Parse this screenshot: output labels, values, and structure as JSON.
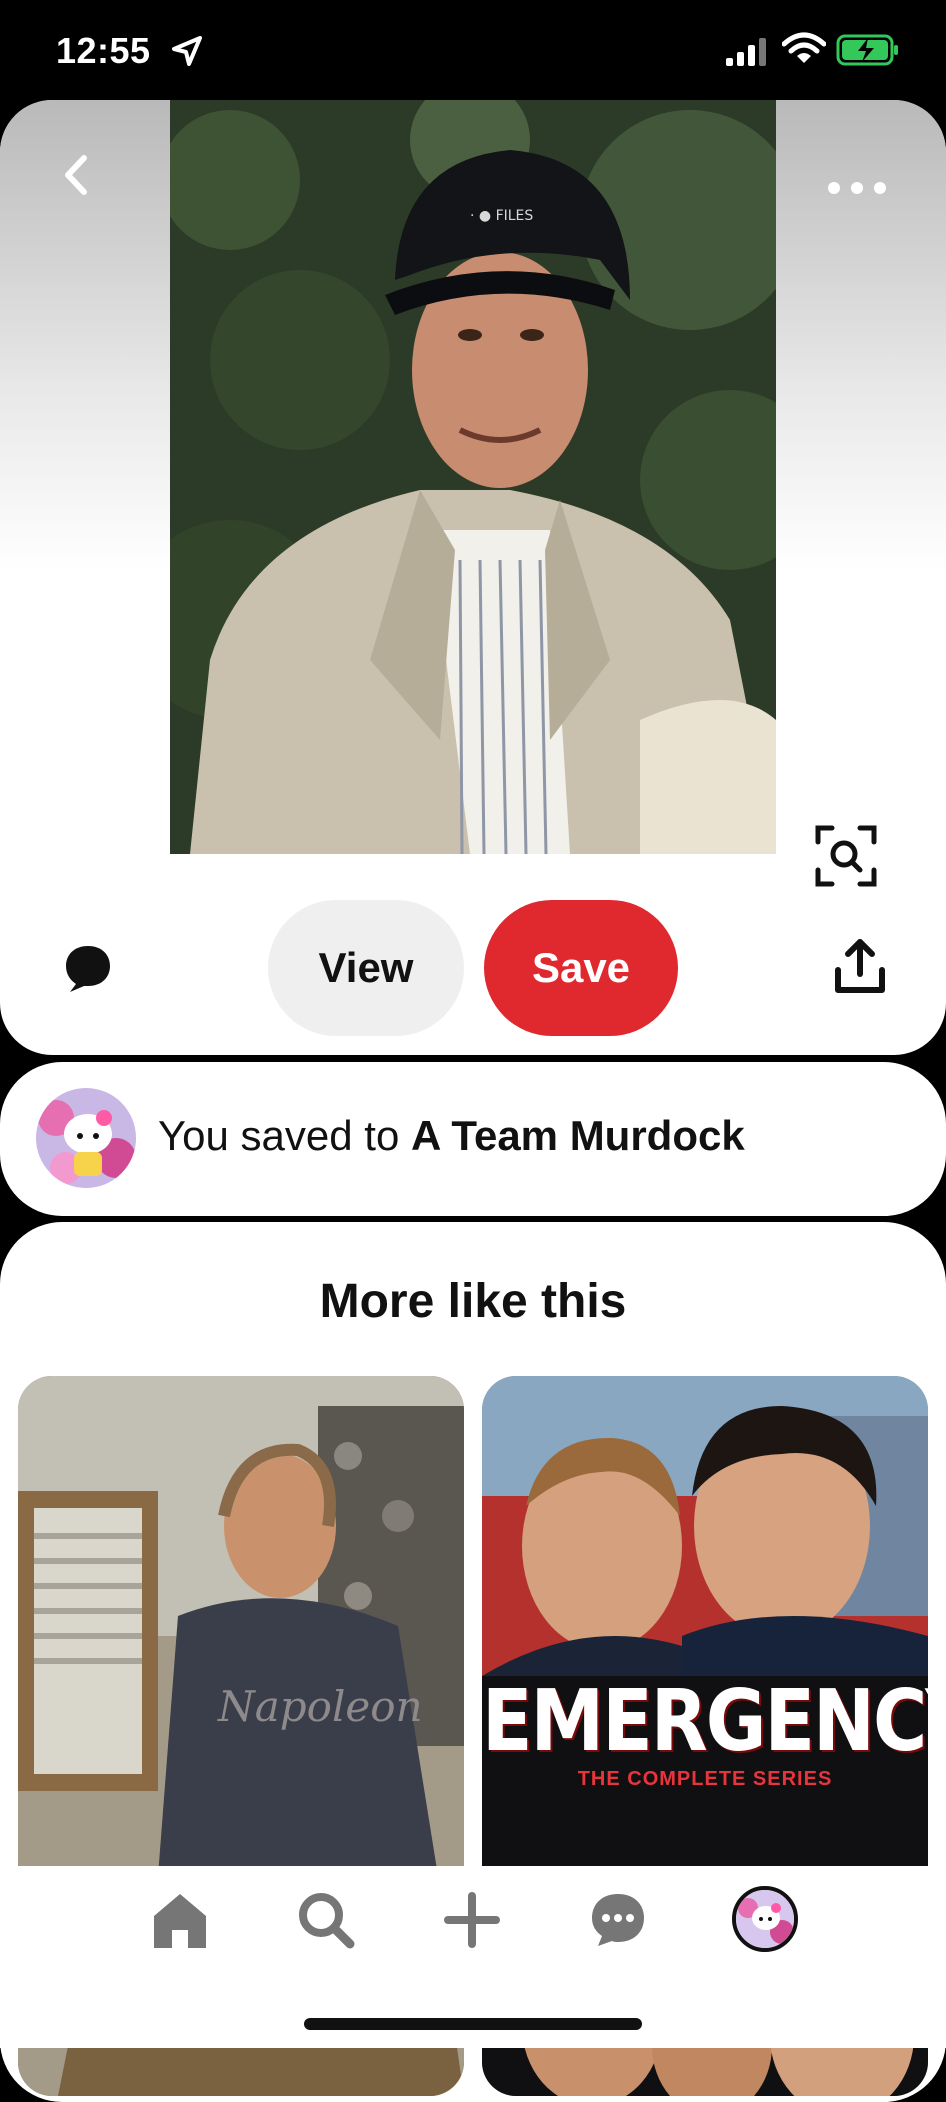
{
  "status_bar": {
    "time": "12:55"
  },
  "pin": {
    "actions": {
      "view_label": "View",
      "save_label": "Save"
    }
  },
  "saved_notice": {
    "prefix": "You saved to ",
    "board_name": "A Team Murdock"
  },
  "more_like_this": {
    "heading": "More like this",
    "items": [
      {
        "poster_title": "",
        "poster_subtitle": ""
      },
      {
        "poster_title": "EMERGENCY!",
        "poster_subtitle": "THE COMPLETE SERIES"
      }
    ]
  },
  "colors": {
    "save_red": "#e0282f",
    "view_gray": "#efefef"
  },
  "icons": [
    "location-arrow-icon",
    "signal-icon",
    "wifi-icon",
    "battery-charging-icon",
    "back-chevron-icon",
    "more-dots-icon",
    "visual-search-icon",
    "comment-icon",
    "share-icon",
    "home-icon",
    "search-icon",
    "plus-icon",
    "messages-icon"
  ]
}
